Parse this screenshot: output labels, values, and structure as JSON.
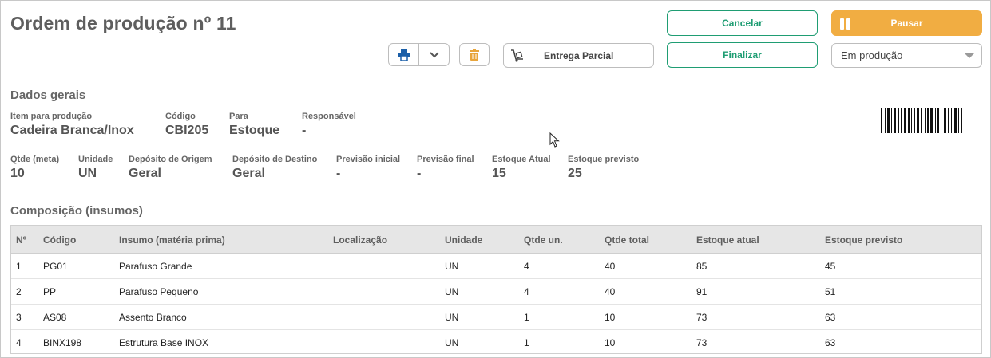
{
  "header": {
    "title": "Ordem de produção nº 11"
  },
  "toolbar": {
    "print_icon": "printer-icon",
    "dropdown_icon": "chevron-down-icon",
    "delete_icon": "trash-icon",
    "partial_delivery_label": "Entrega Parcial",
    "cancel_label": "Cancelar",
    "finish_label": "Finalizar",
    "pause_label": "Pausar",
    "status_select_value": "Em produção"
  },
  "colors": {
    "accent_green": "#1f9d73",
    "pause_orange": "#f1ad42"
  },
  "general": {
    "section_title": "Dados gerais",
    "item_label": "Item para produção",
    "item_value": "Cadeira Branca/Inox",
    "code_label": "Código",
    "code_value": "CBI205",
    "for_label": "Para",
    "for_value": "Estoque",
    "responsible_label": "Responsável",
    "responsible_value": "-",
    "qty_label": "Qtde (meta)",
    "qty_value": "10",
    "unit_label": "Unidade",
    "unit_value": "UN",
    "origin_label": "Depósito de Origem",
    "origin_value": "Geral",
    "dest_label": "Depósito de Destino",
    "dest_value": "Geral",
    "start_label": "Previsão inicial",
    "start_value": "-",
    "end_label": "Previsão final",
    "end_value": "-",
    "stock_label": "Estoque Atual",
    "stock_value": "15",
    "forecast_label": "Estoque previsto",
    "forecast_value": "25"
  },
  "composition": {
    "section_title": "Composição (insumos)",
    "columns": [
      "Nº",
      "Código",
      "Insumo (matéria prima)",
      "Localização",
      "Unidade",
      "Qtde un.",
      "Qtde total",
      "Estoque atual",
      "Estoque previsto"
    ],
    "rows": [
      [
        "1",
        "PG01",
        "Parafuso Grande",
        "",
        "UN",
        "4",
        "40",
        "85",
        "45"
      ],
      [
        "2",
        "PP",
        "Parafuso Pequeno",
        "",
        "UN",
        "4",
        "40",
        "91",
        "51"
      ],
      [
        "3",
        "AS08",
        "Assento Branco",
        "",
        "UN",
        "1",
        "10",
        "73",
        "63"
      ],
      [
        "4",
        "BINX198",
        "Estrutura Base INOX",
        "",
        "UN",
        "1",
        "10",
        "73",
        "63"
      ]
    ]
  }
}
